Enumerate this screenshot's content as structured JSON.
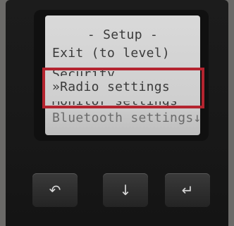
{
  "screen": {
    "title": "- Setup -",
    "items": [
      {
        "label": "Exit (to level)"
      },
      {
        "label": "Security"
      },
      {
        "label": "»Radio settings"
      },
      {
        "label": "Monitor settings"
      },
      {
        "label": "Bluetooth settings↓"
      }
    ]
  },
  "highlight_color": "#b4242f",
  "buttons": [
    {
      "icon": "back-arrow-icon",
      "glyph": "↶"
    },
    {
      "icon": "down-arrow-icon",
      "glyph": "↓"
    },
    {
      "icon": "enter-icon",
      "glyph": "↵"
    }
  ]
}
